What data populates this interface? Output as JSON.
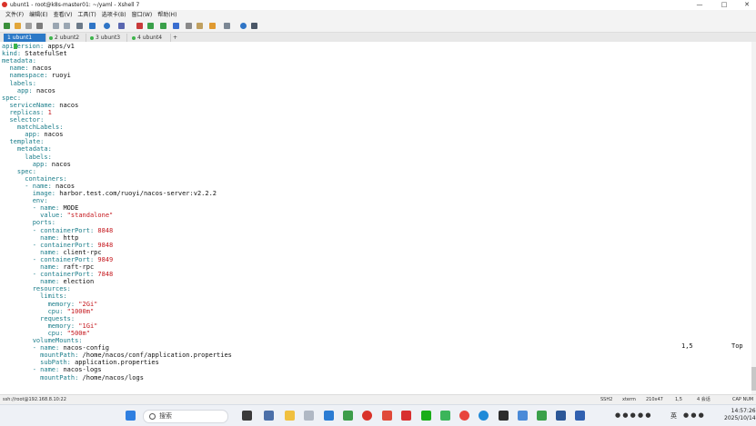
{
  "window": {
    "title": "ubunt1 - root@k8s-master01: ~/yaml - Xshell 7"
  },
  "menu": [
    "文件(F)",
    "编辑(E)",
    "查看(V)",
    "工具(T)",
    "选项卡(B)",
    "窗口(W)",
    "帮助(H)"
  ],
  "tabs": [
    {
      "label": "1 ubunt1",
      "active": true,
      "dot": "#3cb44b"
    },
    {
      "label": "2 ubunt2",
      "active": false,
      "dot": "#3cb44b"
    },
    {
      "label": "3 ubunt3",
      "active": false,
      "dot": "#3cb44b"
    },
    {
      "label": "4 ubunt4",
      "active": false,
      "dot": "#3cb44b"
    }
  ],
  "tab_add": "+",
  "terminal_lines": [
    [
      [
        "k",
        "api"
      ],
      [
        "cursor",
        ""
      ],
      [
        "k",
        "ersion: "
      ],
      [
        "v",
        "apps/v1"
      ]
    ],
    [
      [
        "k",
        "kind: "
      ],
      [
        "v",
        "StatefulSet"
      ]
    ],
    [
      [
        "k",
        "metadata:"
      ]
    ],
    [
      [
        "v",
        "  "
      ],
      [
        "k",
        "name: "
      ],
      [
        "v",
        "nacos"
      ]
    ],
    [
      [
        "v",
        "  "
      ],
      [
        "k",
        "namespace: "
      ],
      [
        "v",
        "ruoyi"
      ]
    ],
    [
      [
        "v",
        "  "
      ],
      [
        "k",
        "labels:"
      ]
    ],
    [
      [
        "v",
        "    "
      ],
      [
        "k",
        "app: "
      ],
      [
        "v",
        "nacos"
      ]
    ],
    [
      [
        "k",
        "spec:"
      ]
    ],
    [
      [
        "v",
        "  "
      ],
      [
        "k",
        "serviceName: "
      ],
      [
        "v",
        "nacos"
      ]
    ],
    [
      [
        "v",
        "  "
      ],
      [
        "k",
        "replicas: "
      ],
      [
        "n",
        "1"
      ]
    ],
    [
      [
        "v",
        "  "
      ],
      [
        "k",
        "selector:"
      ]
    ],
    [
      [
        "v",
        "    "
      ],
      [
        "k",
        "matchLabels:"
      ]
    ],
    [
      [
        "v",
        "      "
      ],
      [
        "k",
        "app: "
      ],
      [
        "v",
        "nacos"
      ]
    ],
    [
      [
        "v",
        "  "
      ],
      [
        "k",
        "template:"
      ]
    ],
    [
      [
        "v",
        "    "
      ],
      [
        "k",
        "metadata:"
      ]
    ],
    [
      [
        "v",
        "      "
      ],
      [
        "k",
        "labels:"
      ]
    ],
    [
      [
        "v",
        "        "
      ],
      [
        "k",
        "app: "
      ],
      [
        "v",
        "nacos"
      ]
    ],
    [
      [
        "v",
        "    "
      ],
      [
        "k",
        "spec:"
      ]
    ],
    [
      [
        "v",
        "      "
      ],
      [
        "k",
        "containers:"
      ]
    ],
    [
      [
        "v",
        "      "
      ],
      [
        "k",
        "- "
      ],
      [
        "k",
        "name: "
      ],
      [
        "v",
        "nacos"
      ]
    ],
    [
      [
        "v",
        "        "
      ],
      [
        "k",
        "image: "
      ],
      [
        "v",
        "harbor.test.com/ruoyi/nacos-server:v2.2.2"
      ]
    ],
    [
      [
        "v",
        "        "
      ],
      [
        "k",
        "env:"
      ]
    ],
    [
      [
        "v",
        "        "
      ],
      [
        "k",
        "- "
      ],
      [
        "k",
        "name: "
      ],
      [
        "v",
        "MODE"
      ]
    ],
    [
      [
        "v",
        "          "
      ],
      [
        "k",
        "value: "
      ],
      [
        "s",
        "\"standalone\""
      ]
    ],
    [
      [
        "v",
        "        "
      ],
      [
        "k",
        "ports:"
      ]
    ],
    [
      [
        "v",
        "        "
      ],
      [
        "k",
        "- "
      ],
      [
        "k",
        "containerPort: "
      ],
      [
        "n",
        "8848"
      ]
    ],
    [
      [
        "v",
        "          "
      ],
      [
        "k",
        "name: "
      ],
      [
        "v",
        "http"
      ]
    ],
    [
      [
        "v",
        "        "
      ],
      [
        "k",
        "- "
      ],
      [
        "k",
        "containerPort: "
      ],
      [
        "n",
        "9848"
      ]
    ],
    [
      [
        "v",
        "          "
      ],
      [
        "k",
        "name: "
      ],
      [
        "v",
        "client-rpc"
      ]
    ],
    [
      [
        "v",
        "        "
      ],
      [
        "k",
        "- "
      ],
      [
        "k",
        "containerPort: "
      ],
      [
        "n",
        "9849"
      ]
    ],
    [
      [
        "v",
        "          "
      ],
      [
        "k",
        "name: "
      ],
      [
        "v",
        "raft-rpc"
      ]
    ],
    [
      [
        "v",
        "        "
      ],
      [
        "k",
        "- "
      ],
      [
        "k",
        "containerPort: "
      ],
      [
        "n",
        "7848"
      ]
    ],
    [
      [
        "v",
        "          "
      ],
      [
        "k",
        "name: "
      ],
      [
        "v",
        "election"
      ]
    ],
    [
      [
        "v",
        "        "
      ],
      [
        "k",
        "resources:"
      ]
    ],
    [
      [
        "v",
        "          "
      ],
      [
        "k",
        "limits:"
      ]
    ],
    [
      [
        "v",
        "            "
      ],
      [
        "k",
        "memory: "
      ],
      [
        "s",
        "\"2Gi\""
      ]
    ],
    [
      [
        "v",
        "            "
      ],
      [
        "k",
        "cpu: "
      ],
      [
        "s",
        "\"1000m\""
      ]
    ],
    [
      [
        "v",
        "          "
      ],
      [
        "k",
        "requests:"
      ]
    ],
    [
      [
        "v",
        "            "
      ],
      [
        "k",
        "memory: "
      ],
      [
        "s",
        "\"1Gi\""
      ]
    ],
    [
      [
        "v",
        "            "
      ],
      [
        "k",
        "cpu: "
      ],
      [
        "s",
        "\"500m\""
      ]
    ],
    [
      [
        "v",
        "        "
      ],
      [
        "k",
        "volumeMounts:"
      ]
    ],
    [
      [
        "v",
        "        "
      ],
      [
        "k",
        "- "
      ],
      [
        "k",
        "name: "
      ],
      [
        "v",
        "nacos-config"
      ]
    ],
    [
      [
        "v",
        "          "
      ],
      [
        "k",
        "mountPath: "
      ],
      [
        "v",
        "/home/nacos/conf/application.properties"
      ]
    ],
    [
      [
        "v",
        "          "
      ],
      [
        "k",
        "subPath: "
      ],
      [
        "v",
        "application.properties"
      ]
    ],
    [
      [
        "v",
        "        "
      ],
      [
        "k",
        "- "
      ],
      [
        "k",
        "name: "
      ],
      [
        "v",
        "nacos-logs"
      ]
    ],
    [
      [
        "v",
        "          "
      ],
      [
        "k",
        "mountPath: "
      ],
      [
        "v",
        "/home/nacos/logs"
      ]
    ]
  ],
  "vim_status": {
    "position": "1,5",
    "scroll": "Top"
  },
  "statusbar": {
    "connection": "ssh://root@192.168.8.10:22",
    "protocol": "SSH2",
    "terminal": "xterm",
    "size": "210x47",
    "cursor": "1,5",
    "sessions": "4 会话",
    "caps": "CAP NUM"
  },
  "taskbar": {
    "search_placeholder": "搜索",
    "ime": "英",
    "time": "14:57:26",
    "date": "2025/10/14"
  }
}
